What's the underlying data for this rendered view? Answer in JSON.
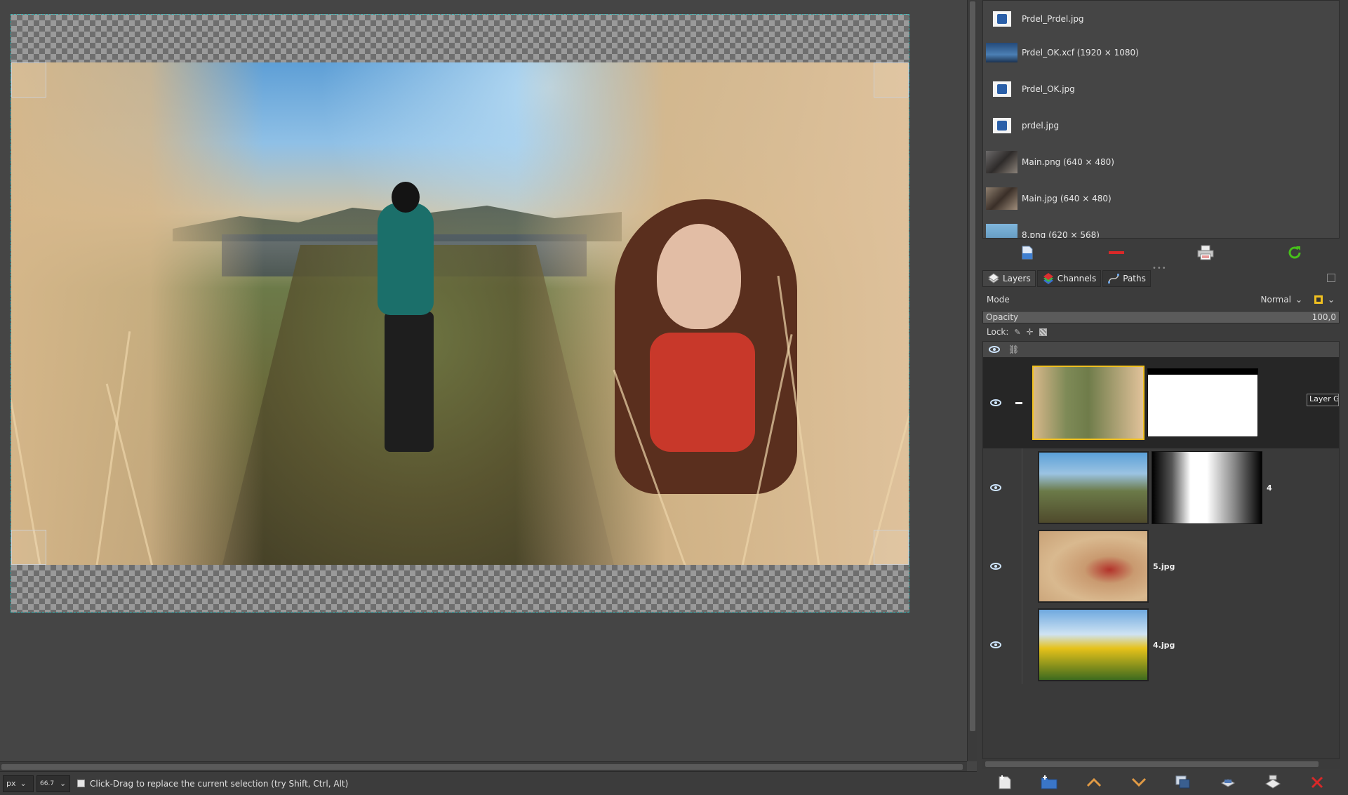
{
  "status": {
    "unit": "px",
    "zoom": "66.7 %",
    "message": "Click-Drag to replace the current selection (try Shift, Ctrl, Alt)"
  },
  "images": [
    {
      "label": "Prdel_Prdel.jpg",
      "icon": "file-image-icon"
    },
    {
      "label": "Prdel_OK.xcf (1920 × 1080)",
      "icon": "image-thumbnail"
    },
    {
      "label": "Prdel_OK.jpg",
      "icon": "file-image-icon"
    },
    {
      "label": "prdel.jpg",
      "icon": "file-image-icon"
    },
    {
      "label": "Main.png (640 × 480)",
      "icon": "image-thumbnail"
    },
    {
      "label": "Main.jpg (640 × 480)",
      "icon": "image-thumbnail"
    },
    {
      "label": "8.png (620 × 568)",
      "icon": "image-thumbnail"
    }
  ],
  "images_toolbar": [
    "new-view-icon",
    "delete-icon",
    "print-icon",
    "refresh-icon"
  ],
  "tabs": [
    {
      "label": "Layers",
      "icon": "layers-icon"
    },
    {
      "label": "Channels",
      "icon": "channels-icon"
    },
    {
      "label": "Paths",
      "icon": "paths-icon"
    }
  ],
  "mode": {
    "label": "Mode",
    "value": "Normal"
  },
  "opacity": {
    "label": "Opacity",
    "value": "100,0"
  },
  "lock": {
    "label": "Lock:"
  },
  "layers": {
    "group_mask_label": "Layer G",
    "child1_label": "4",
    "child2_label": "5.jpg",
    "child3_label": "4.jpg"
  },
  "colors": {
    "selection_outline": "#3fb5b5",
    "refresh_green": "#46c01a",
    "delete_red": "#d92828"
  }
}
